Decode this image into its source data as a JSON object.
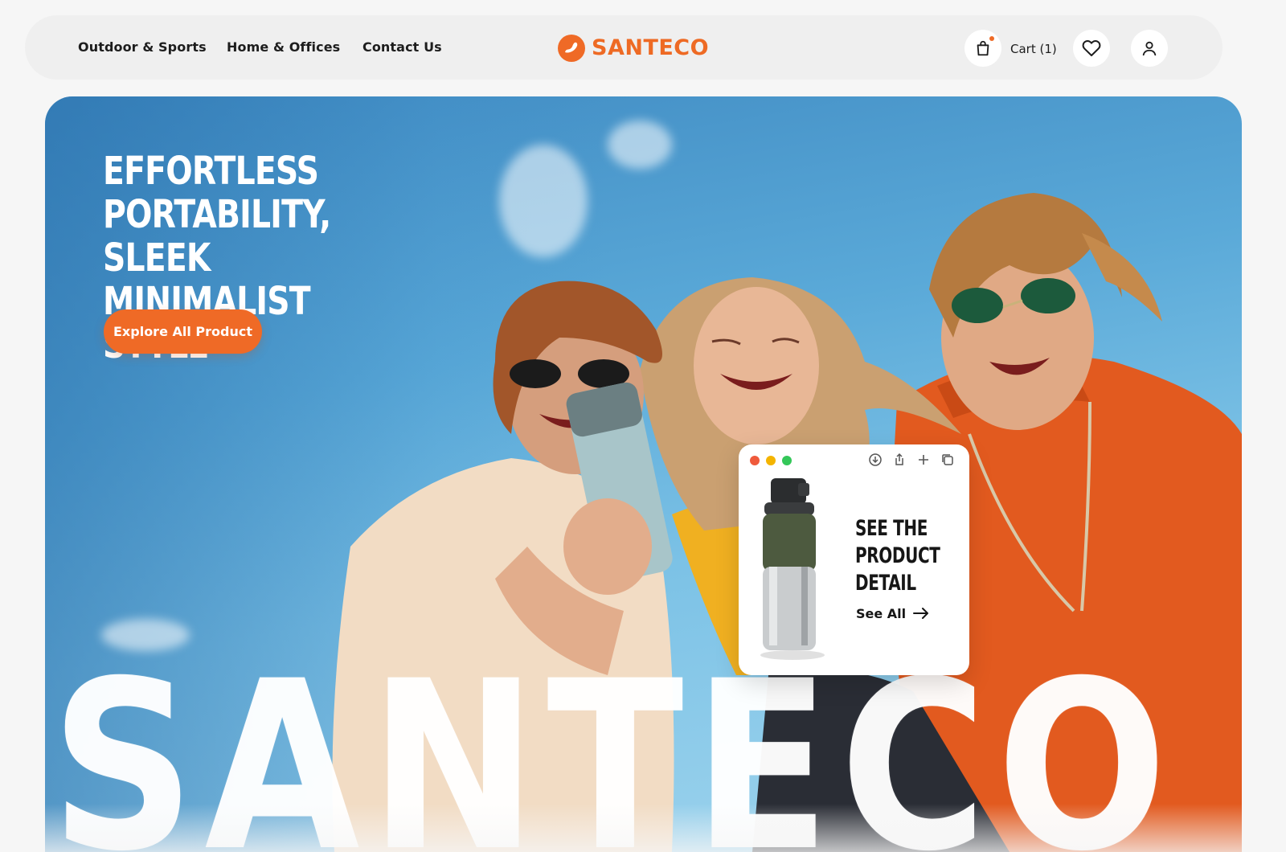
{
  "nav": {
    "links": [
      "Outdoor & Sports",
      "Home & Offices",
      "Contact Us"
    ],
    "logo_text": "SANTECO",
    "cart_label": "Cart (1)",
    "icons": [
      "shopping-bag-icon",
      "heart-icon",
      "user-icon"
    ]
  },
  "hero": {
    "headline": [
      "EFFORTLESS",
      "PORTABILITY, SLEEK",
      "MINIMALIST STYLE"
    ],
    "cta_label": "Explore All Product",
    "brand_watermark": "SANTECO"
  },
  "product_card": {
    "window_dots": [
      "#ef5a3c",
      "#f4b400",
      "#34c759"
    ],
    "toolbar_icons": [
      "download-icon",
      "share-icon",
      "plus-icon",
      "copy-icon"
    ],
    "title": [
      "SEE THE",
      "PRODUCT",
      "DETAIL"
    ],
    "link_label": "See All"
  },
  "colors": {
    "accent": "#ef6a26",
    "sky": "#5aa9d8",
    "text": "#1d1d1d"
  }
}
